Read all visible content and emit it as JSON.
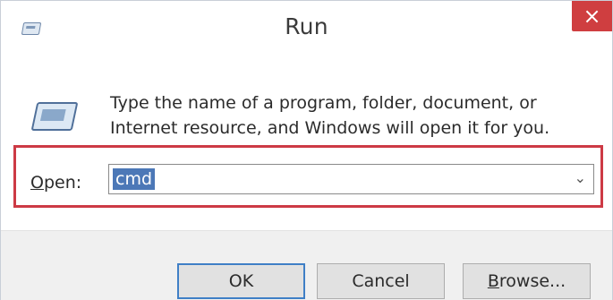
{
  "window": {
    "title": "Run",
    "close_symbol": "×"
  },
  "icons": {
    "title_icon": "run-app-icon",
    "content_icon": "run-app-icon"
  },
  "instructions": "Type the name of a program, folder, document, or Internet resource, and Windows will open it for you.",
  "open_field": {
    "label_mnemonic": "O",
    "label_rest": "pen:",
    "value": "cmd",
    "dropdown_symbol": "⌄"
  },
  "buttons": {
    "ok": "OK",
    "cancel": "Cancel",
    "browse_mnemonic": "B",
    "browse_rest": "rowse..."
  },
  "colors": {
    "highlight_border": "#cd3a45",
    "close_button": "#cf3e40",
    "selection": "#4c78b7",
    "default_button_border": "#3f7fc6"
  }
}
